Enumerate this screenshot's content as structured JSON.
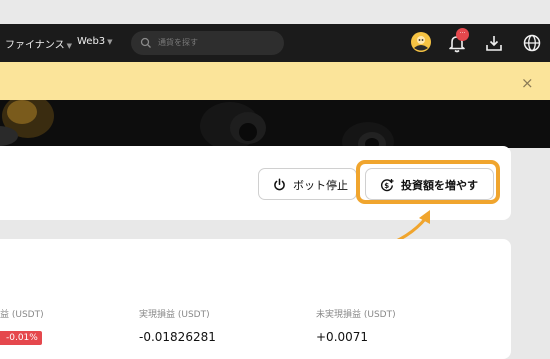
{
  "nav": {
    "finance_label": "ファイナンス",
    "web3_label": "Web3",
    "search_placeholder": "通貨を探す",
    "notification_badge": "···"
  },
  "banner": {
    "close_label": "×"
  },
  "actions": {
    "stop_bot_label": "ボット停止",
    "increase_investment_label": "投資額を増やす"
  },
  "stats": {
    "col1_label": "益 (USDT)",
    "col1_badge": "-0.01%",
    "realized_label": "実現損益 (USDT)",
    "realized_value": "-0.01826281",
    "unrealized_label": "未実現損益 (USDT)",
    "unrealized_value": "+0.0071"
  },
  "colors": {
    "nav_bg": "#1b1b1b",
    "banner_bg": "#fbe49a",
    "highlight": "#f0a52e",
    "negative": "#e5484d"
  }
}
